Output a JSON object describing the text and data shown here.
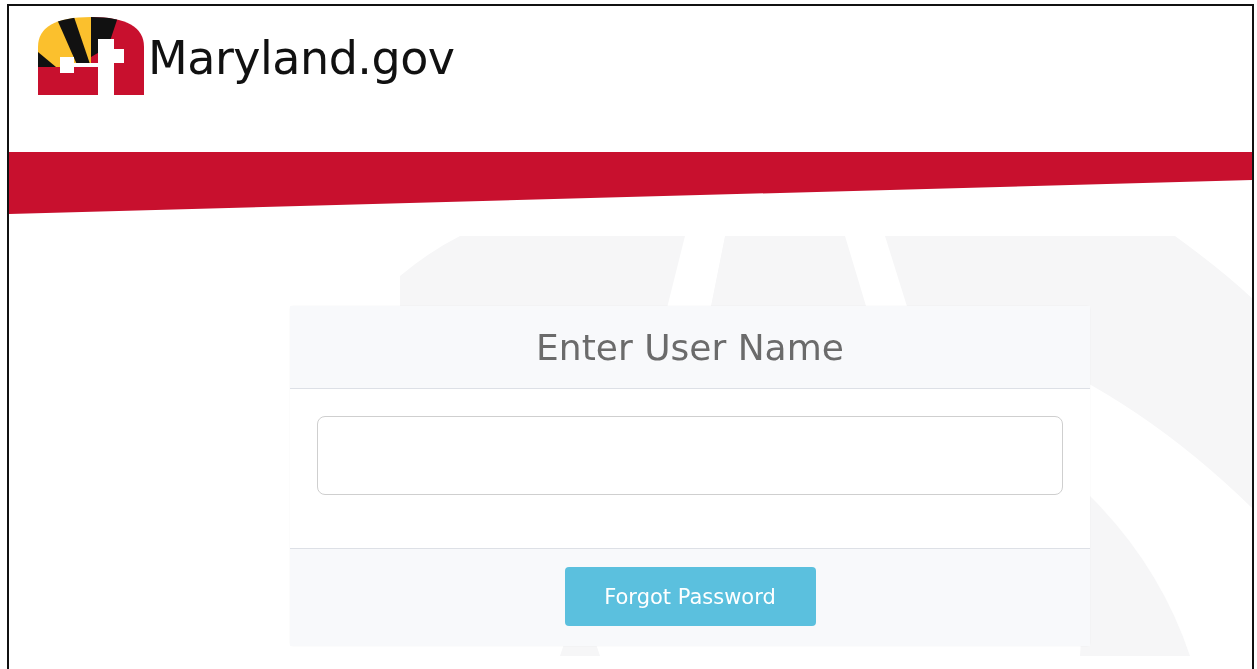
{
  "header": {
    "site_name": "Maryland.gov"
  },
  "card": {
    "title": "Enter User Name",
    "button": "Forgot Password"
  }
}
